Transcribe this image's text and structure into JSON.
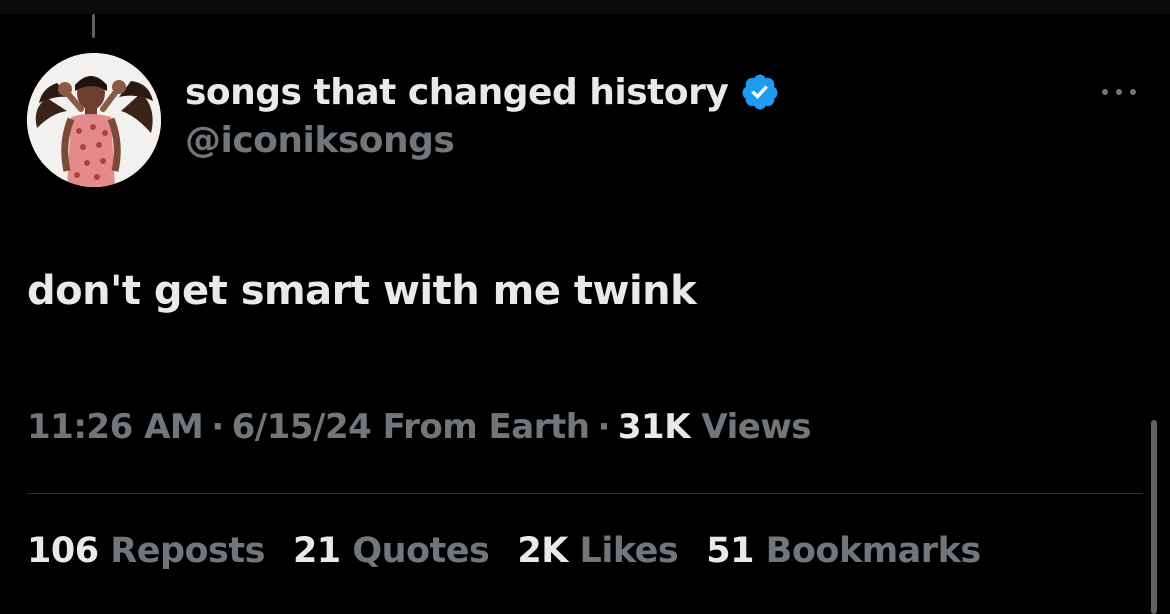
{
  "tweet": {
    "author": {
      "display_name": "songs that changed history",
      "handle": "@iconiksongs",
      "verified": true,
      "avatar_icon": "profile-photo"
    },
    "text": "don't get smart with me twink",
    "time": "11:26 AM",
    "date": "6/15/24",
    "source": "From Earth",
    "views_count": "31K",
    "views_label": "Views",
    "separator": "·",
    "more_icon": "ellipsis-icon"
  },
  "stats": [
    {
      "count": "106",
      "label": "Reposts"
    },
    {
      "count": "21",
      "label": "Quotes"
    },
    {
      "count": "2K",
      "label": "Likes"
    },
    {
      "count": "51",
      "label": "Bookmarks"
    }
  ],
  "colors": {
    "background": "#000000",
    "primary_text": "#e7e9ea",
    "secondary_text": "#71767b",
    "verified_blue": "#1d9bf0",
    "divider": "#2f3336"
  }
}
